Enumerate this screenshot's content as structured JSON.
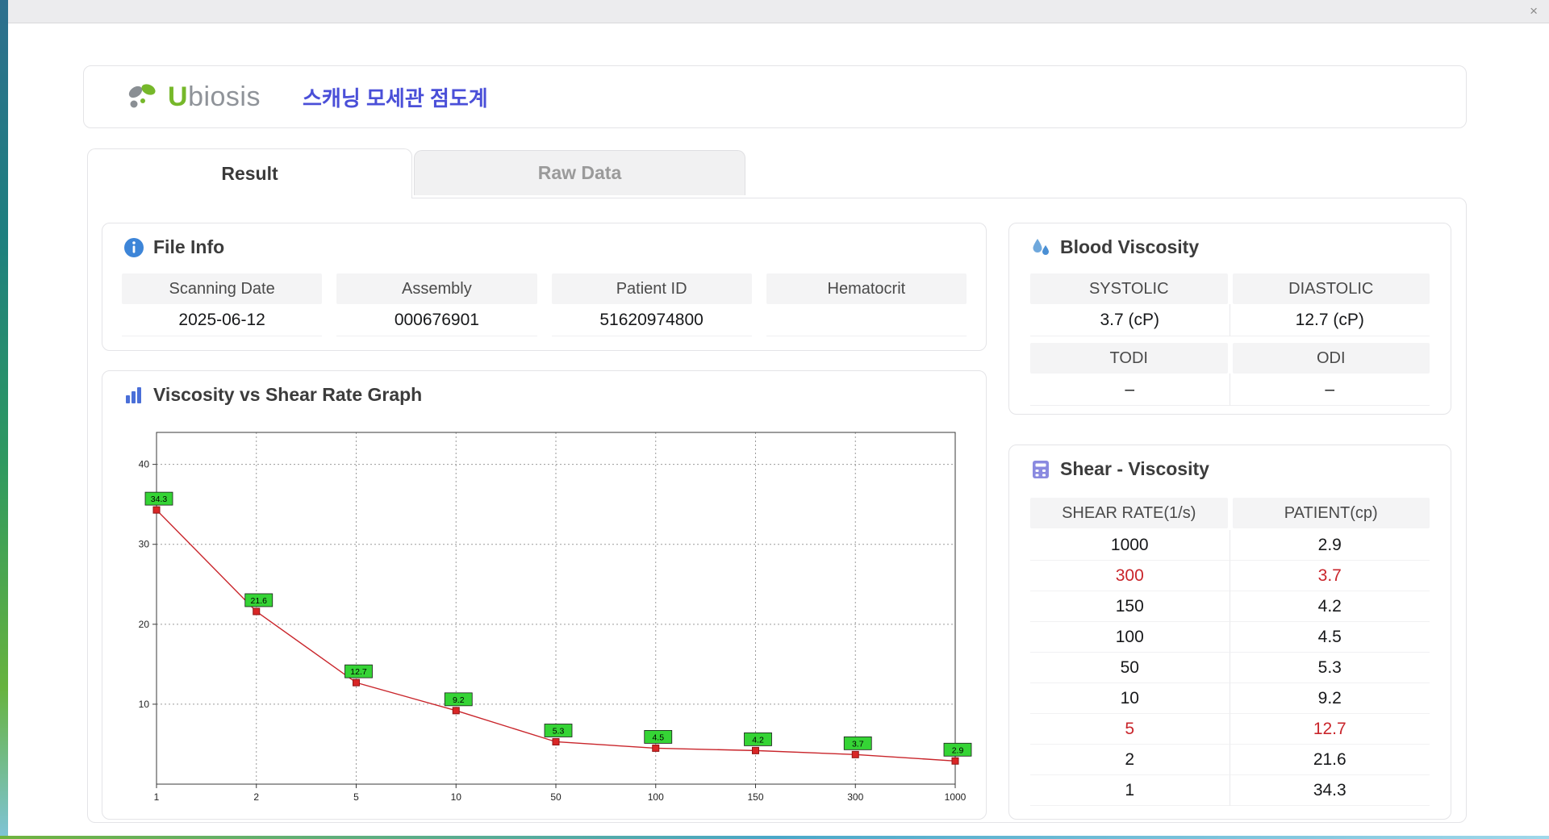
{
  "window": {
    "close_label": "×"
  },
  "header": {
    "logo_u": "U",
    "logo_rest": "biosis",
    "title": "스캐닝 모세관 점도계"
  },
  "tabs": [
    {
      "label": "Result",
      "active": true
    },
    {
      "label": "Raw Data",
      "active": false
    }
  ],
  "file_info": {
    "title": "File Info",
    "fields": [
      {
        "label": "Scanning Date",
        "value": "2025-06-12"
      },
      {
        "label": "Assembly",
        "value": "000676901"
      },
      {
        "label": "Patient ID",
        "value": "51620974800"
      },
      {
        "label": "Hematocrit",
        "value": ""
      }
    ]
  },
  "blood_viscosity": {
    "title": "Blood Viscosity",
    "row1": {
      "headers": [
        "SYSTOLIC",
        "DIASTOLIC"
      ],
      "values": [
        "3.7 (cP)",
        "12.7 (cP)"
      ]
    },
    "row2": {
      "headers": [
        "TODI",
        "ODI"
      ],
      "values": [
        "–",
        "–"
      ]
    }
  },
  "shear_viscosity": {
    "title": "Shear - Viscosity",
    "headers": [
      "SHEAR RATE(1/s)",
      "PATIENT(cp)"
    ],
    "rows": [
      {
        "shear": "1000",
        "patient": "2.9",
        "highlight": false
      },
      {
        "shear": "300",
        "patient": "3.7",
        "highlight": true
      },
      {
        "shear": "150",
        "patient": "4.2",
        "highlight": false
      },
      {
        "shear": "100",
        "patient": "4.5",
        "highlight": false
      },
      {
        "shear": "50",
        "patient": "5.3",
        "highlight": false
      },
      {
        "shear": "10",
        "patient": "9.2",
        "highlight": false
      },
      {
        "shear": "5",
        "patient": "12.7",
        "highlight": true
      },
      {
        "shear": "2",
        "patient": "21.6",
        "highlight": false
      },
      {
        "shear": "1",
        "patient": "34.3",
        "highlight": false
      }
    ]
  },
  "chart_data": {
    "type": "line",
    "title": "Viscosity vs Shear Rate Graph",
    "categories": [
      "1",
      "2",
      "5",
      "10",
      "50",
      "100",
      "150",
      "300",
      "1000"
    ],
    "values": [
      34.3,
      21.6,
      12.7,
      9.2,
      5.3,
      4.5,
      4.2,
      3.7,
      2.9
    ],
    "xlabel": "",
    "ylabel": "",
    "yticks": [
      10,
      20,
      30,
      40
    ],
    "ylim": [
      0,
      44
    ],
    "grid": "dashed",
    "legend": "none",
    "line_color": "#c9252b",
    "marker_color": "#d92626",
    "label_bg": "#35d435"
  },
  "colors": {
    "accent": "#4a4fd8",
    "highlight_red": "#c9252b",
    "label_green": "#35d435",
    "logo_green": "#76b82a"
  }
}
